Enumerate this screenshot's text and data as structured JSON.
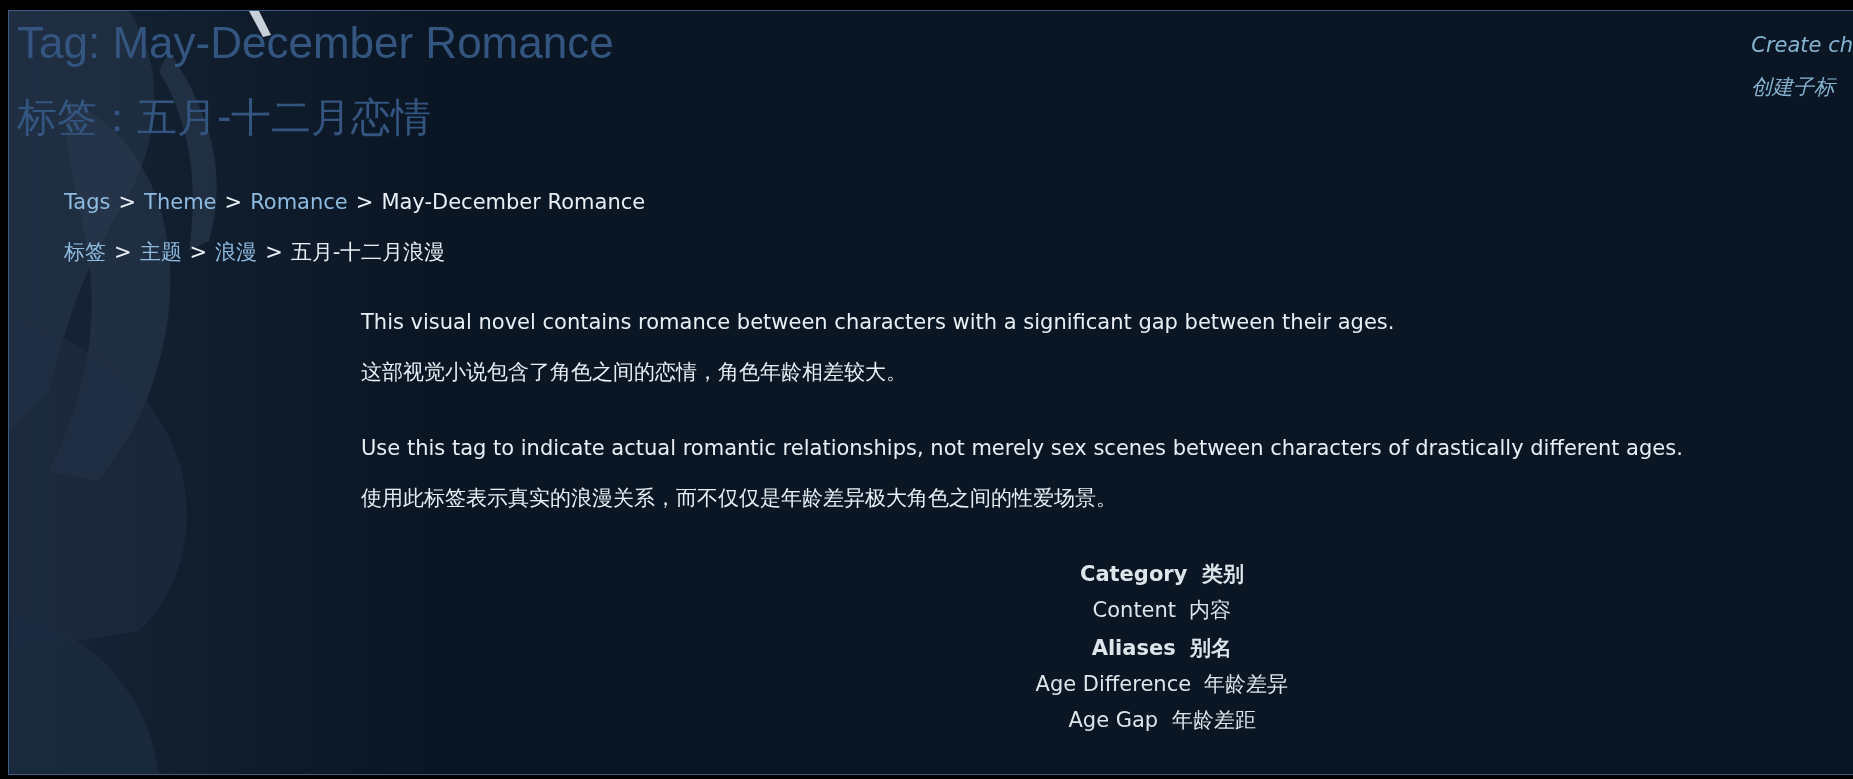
{
  "title": "Tag: May-December Romance",
  "title_zh": "标签：五月-十二月恋情",
  "side_links": [
    {
      "label": "Create ch"
    },
    {
      "label": "创建子标"
    }
  ],
  "breadcrumbs": [
    {
      "items": [
        {
          "label": "Tags",
          "kind": "link"
        },
        {
          "label": "Theme",
          "kind": "link"
        },
        {
          "label": "Romance",
          "kind": "link"
        },
        {
          "label": "May-December Romance",
          "kind": "current"
        }
      ]
    },
    {
      "items": [
        {
          "label": "标签",
          "kind": "link"
        },
        {
          "label": "主题",
          "kind": "link"
        },
        {
          "label": "浪漫",
          "kind": "link"
        },
        {
          "label": "五月-十二月浪漫",
          "kind": "current"
        }
      ]
    }
  ],
  "separator": ">",
  "description": [
    [
      "This visual novel contains romance between characters with a significant gap between their ages.",
      "这部视觉小说包含了角色之间的恋情，角色年龄相差较大。"
    ],
    [
      "Use this tag to indicate actual romantic relationships, not merely sex scenes between characters of drastically different ages.",
      "使用此标签表示真实的浪漫关系，而不仅仅是年龄差异极大角色之间的性爱场景。"
    ]
  ],
  "properties": [
    {
      "label": "Category  类别",
      "values": [
        "Content  内容"
      ]
    },
    {
      "label": "Aliases  别名",
      "values": [
        "Age Difference  年龄差异",
        "Age Gap  年龄差距"
      ]
    }
  ]
}
